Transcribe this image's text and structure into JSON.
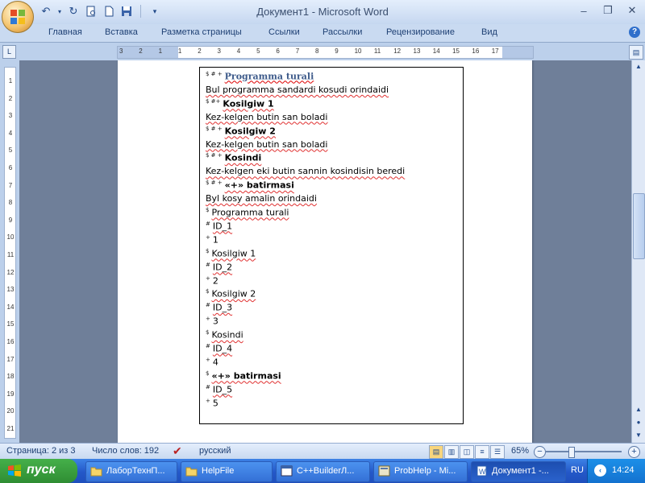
{
  "window": {
    "title": "Документ1 - Microsoft Word"
  },
  "quick_access": {
    "undo": "undo-icon",
    "redo": "redo-icon",
    "print_preview": "print-preview-icon",
    "new": "new-document-icon",
    "save": "save-icon"
  },
  "ribbon_tabs": [
    "Главная",
    "Вставка",
    "Разметка страницы",
    "Ссылки",
    "Рассылки",
    "Рецензирование",
    "Вид"
  ],
  "ruler": {
    "h": [
      "3",
      "2",
      "1",
      "1",
      "2",
      "3",
      "4",
      "5",
      "6",
      "7",
      "8",
      "9",
      "10",
      "11",
      "12",
      "13",
      "14",
      "15",
      "16",
      "17"
    ],
    "v": [
      "1",
      "2",
      "3",
      "4",
      "5",
      "6",
      "7",
      "8",
      "9",
      "10",
      "11",
      "12",
      "13",
      "14",
      "15",
      "16",
      "17",
      "18",
      "19",
      "20",
      "21"
    ]
  },
  "document": {
    "lines": [
      {
        "marks": "$ # +",
        "text": "Programma turali",
        "style": "heading"
      },
      {
        "marks": "",
        "text": "Bul programma sandardi kosudi orindaidi",
        "style": "squiggle"
      },
      {
        "marks": "$ #+",
        "text": "Kosilgiw 1",
        "style": "bold"
      },
      {
        "marks": "",
        "text": "Kez-kelgen butin san boladi",
        "style": "squiggle"
      },
      {
        "marks": "$ # +",
        "text": "Kosilgiw 2",
        "style": "bold"
      },
      {
        "marks": "",
        "text": "Kez-kelgen butin san boladi",
        "style": "squiggle"
      },
      {
        "marks": "$ # +",
        "text": "Kosindi",
        "style": "bold"
      },
      {
        "marks": "",
        "text": "Kez-kelgen eki butin sannin kosindisin beredi",
        "style": "squiggle"
      },
      {
        "marks": "$ # +",
        "text": "«+»   batirmasi",
        "style": "bold"
      },
      {
        "marks": "",
        "text": "Byl kosy amalin orindaidi",
        "style": "squiggle"
      },
      {
        "marks": "$",
        "text": "Programma turali",
        "style": "squiggle"
      },
      {
        "marks": "#",
        "text": "ID_1",
        "style": "squiggle"
      },
      {
        "marks": "+",
        "text": "1",
        "style": "plain"
      },
      {
        "marks": "$",
        "text": "Kosilgiw 1",
        "style": "squiggle"
      },
      {
        "marks": "#",
        "text": "ID_2",
        "style": "squiggle"
      },
      {
        "marks": "+",
        "text": "2",
        "style": "plain"
      },
      {
        "marks": "$",
        "text": "Kosilgiw 2",
        "style": "squiggle"
      },
      {
        "marks": "#",
        "text": "ID_3",
        "style": "squiggle"
      },
      {
        "marks": "+",
        "text": "3",
        "style": "plain"
      },
      {
        "marks": "$",
        "text": "Kosindi",
        "style": "squiggle"
      },
      {
        "marks": "#",
        "text": "ID_4",
        "style": "squiggle"
      },
      {
        "marks": "+",
        "text": "4",
        "style": "plain"
      },
      {
        "marks": "$",
        "text": "«+»   batirmasi",
        "style": "bold"
      },
      {
        "marks": "#",
        "text": "ID_5",
        "style": "squiggle"
      },
      {
        "marks": "+",
        "text": "5",
        "style": "plain"
      }
    ]
  },
  "status": {
    "page": "Страница: 2 из 3",
    "words": "Число слов: 192",
    "language": "русский",
    "zoom": "65%"
  },
  "taskbar": {
    "start_label": "пуск",
    "tasks": [
      {
        "label": "ЛаборТехнП...",
        "icon": "folder-icon"
      },
      {
        "label": "HelpFile",
        "icon": "folder-icon"
      },
      {
        "label": "C++BuilderЛ...",
        "icon": "app-window-icon"
      },
      {
        "label": "ProbHelp - Mi...",
        "icon": "help-workshop-icon"
      },
      {
        "label": "Документ1 -...",
        "icon": "word-document-icon"
      }
    ],
    "lang": "RU",
    "clock": "14:24"
  }
}
